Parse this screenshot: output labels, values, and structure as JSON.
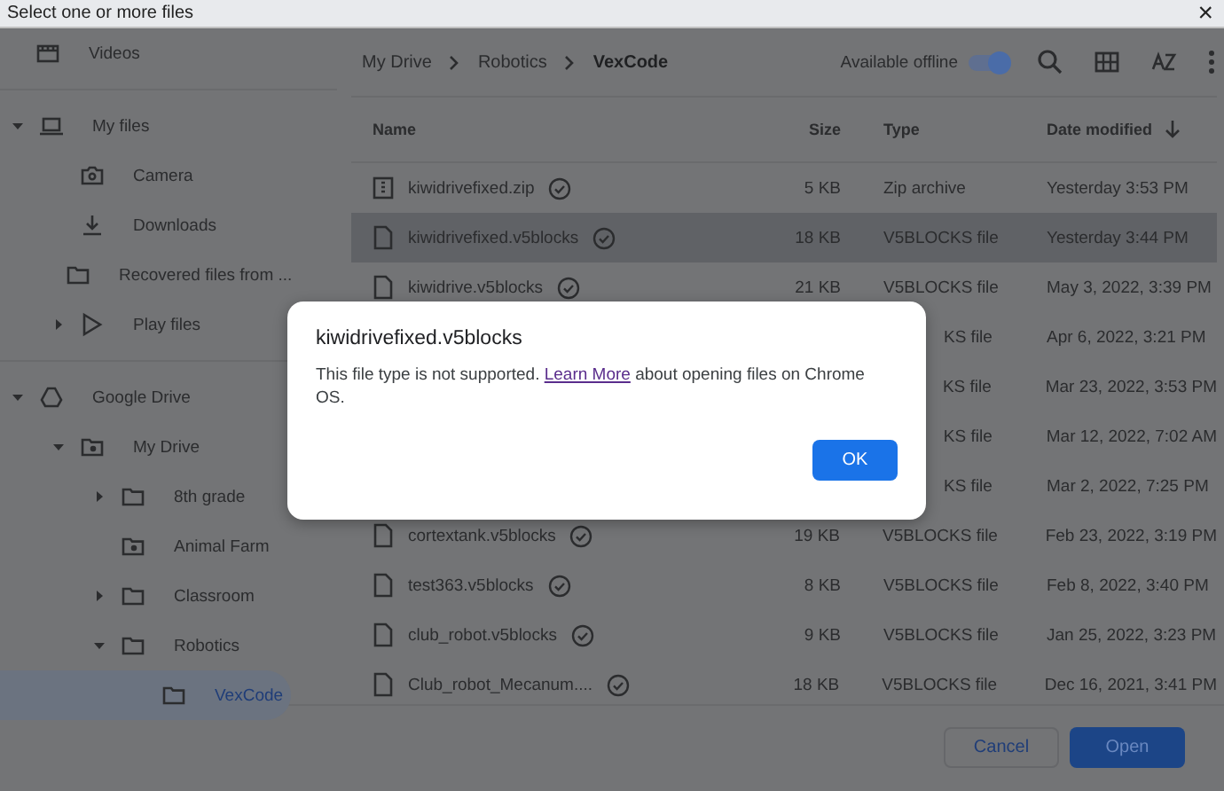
{
  "window": {
    "title": "Select one or more files",
    "close": "×"
  },
  "sidebar": {
    "items": [
      {
        "label": "Videos",
        "kind": "film"
      },
      {
        "label": "My files",
        "kind": "computer",
        "expanded": true,
        "children": [
          {
            "label": "Camera",
            "kind": "camera"
          },
          {
            "label": "Downloads",
            "kind": "download"
          },
          {
            "label": "Recovered files from ...",
            "kind": "folder"
          },
          {
            "label": "Play files",
            "kind": "play",
            "expanded": false
          }
        ]
      },
      {
        "label": "Google Drive",
        "kind": "drive",
        "expanded": true,
        "children": [
          {
            "label": "My Drive",
            "kind": "shared",
            "expanded": true,
            "children": [
              {
                "label": "8th grade",
                "kind": "folder",
                "expanded": false
              },
              {
                "label": "Animal Farm",
                "kind": "shared"
              },
              {
                "label": "Classroom",
                "kind": "folder",
                "expanded": false
              },
              {
                "label": "Robotics",
                "kind": "folder",
                "expanded": true,
                "children": [
                  {
                    "label": "VexCode",
                    "kind": "folder",
                    "selected": true
                  }
                ]
              }
            ]
          }
        ]
      }
    ]
  },
  "breadcrumb": [
    "My Drive",
    "Robotics",
    "VexCode"
  ],
  "toolbar": {
    "offline_label": "Available offline",
    "offline_on": true
  },
  "table": {
    "columns": [
      "Name",
      "Size",
      "Type",
      "Date modified"
    ],
    "rows": [
      {
        "kind": "zip",
        "name": "kiwidrivefixed.zip",
        "size": "5 KB",
        "type": "Zip archive",
        "date": "Yesterday 3:53 PM",
        "selected": false
      },
      {
        "kind": "file",
        "name": "kiwidrivefixed.v5blocks",
        "size": "18 KB",
        "type": "V5BLOCKS file",
        "date": "Yesterday 3:44 PM",
        "selected": true
      },
      {
        "kind": "file",
        "name": "kiwidrive.v5blocks",
        "size": "21 KB",
        "type": "V5BLOCKS file",
        "date": "May 3, 2022, 3:39 PM",
        "selected": false
      },
      {
        "kind": "covered",
        "type": "KS file",
        "date": "Apr 6, 2022, 3:21 PM",
        "selected": false
      },
      {
        "kind": "covered",
        "type": "KS file",
        "date": "Mar 23, 2022, 3:53 PM",
        "selected": false
      },
      {
        "kind": "covered",
        "type": "KS file",
        "date": "Mar 12, 2022, 7:02 AM",
        "selected": false
      },
      {
        "kind": "covered",
        "type": "KS file",
        "date": "Mar 2, 2022, 7:25 PM",
        "selected": false
      },
      {
        "kind": "file",
        "name": "cortextank.v5blocks",
        "size": "19 KB",
        "type": "V5BLOCKS file",
        "date": "Feb 23, 2022, 3:19 PM",
        "selected": false
      },
      {
        "kind": "file",
        "name": "test363.v5blocks",
        "size": "8 KB",
        "type": "V5BLOCKS file",
        "date": "Feb 8, 2022, 3:40 PM",
        "selected": false
      },
      {
        "kind": "file",
        "name": "club_robot.v5blocks",
        "size": "9 KB",
        "type": "V5BLOCKS file",
        "date": "Jan 25, 2022, 3:23 PM",
        "selected": false
      },
      {
        "kind": "file",
        "name": "Club_robot_Mecanum....",
        "size": "18 KB",
        "type": "V5BLOCKS file",
        "date": "Dec 16, 2021, 3:41 PM",
        "selected": false
      }
    ]
  },
  "footer": {
    "buttons": [
      "Cancel",
      "Open"
    ]
  },
  "dialog": {
    "title": "kiwidrivefixed.v5blocks",
    "text_before": "This file type is not supported.",
    "link": "Learn More",
    "text_after": "about opening files on Chrome OS.",
    "button": "OK"
  }
}
